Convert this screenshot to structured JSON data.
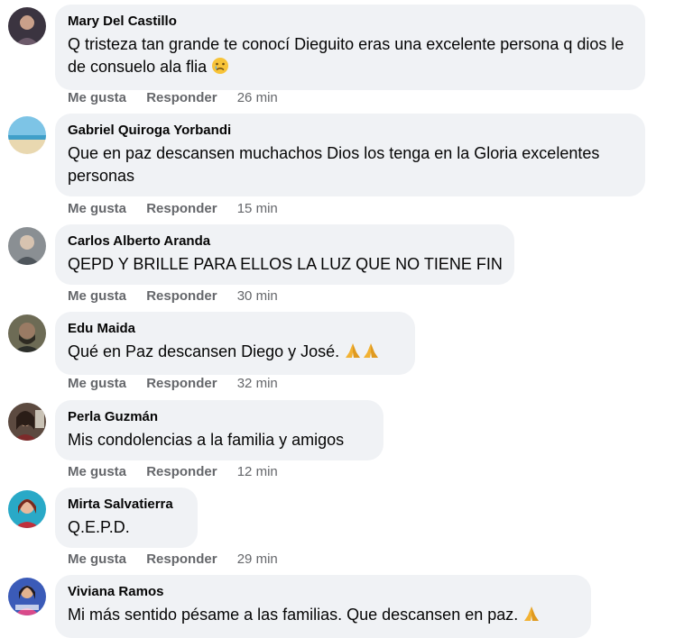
{
  "actions": {
    "like": "Me gusta",
    "reply": "Responder"
  },
  "comments": [
    {
      "author": "Mary Del Castillo",
      "text": "Q tristeza tan grande te conocí Dieguito eras una excelente persona q dios le de consuelo ala flia",
      "emoji": "sad-face-icon",
      "time": "26 min"
    },
    {
      "author": "Gabriel Quiroga Yorbandi",
      "text": "Que en paz descansen muchachos Dios los tenga en la Gloria excelentes personas",
      "emoji": "",
      "time": "15 min"
    },
    {
      "author": "Carlos Alberto Aranda",
      "text": "QEPD Y BRILLE PARA ELLOS LA LUZ QUE NO TIENE FIN",
      "emoji": "",
      "time": "30 min"
    },
    {
      "author": "Edu Maida",
      "text": "Qué en Paz descansen Diego y José.",
      "emoji": "folded-hands-icon x2",
      "time": "32 min"
    },
    {
      "author": "Perla Guzmán",
      "text": "Mis condolencias a la familia y amigos",
      "emoji": "",
      "time": "12 min"
    },
    {
      "author": "Mirta Salvatierra",
      "text": "Q.E.P.D.",
      "emoji": "",
      "time": "29 min"
    },
    {
      "author": "Viviana Ramos",
      "text": "Mi más sentido pésame a las familias. Que descansen en paz.",
      "emoji": "folded-hands-icon",
      "time": ""
    }
  ]
}
